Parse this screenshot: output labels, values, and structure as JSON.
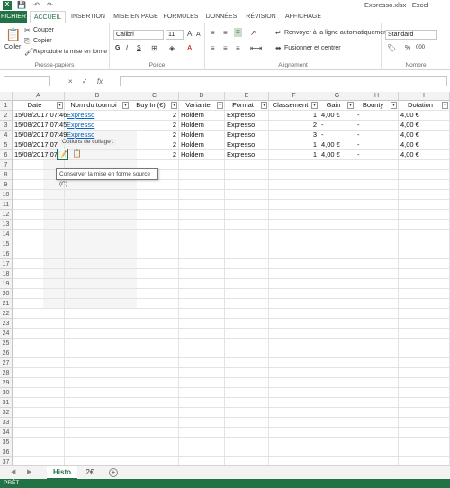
{
  "window": {
    "title": "Expresso.xlsx - Excel",
    "app_icon": "X"
  },
  "qat": {
    "save_icon": "save-icon",
    "undo_icon": "undo-icon",
    "redo_icon": "redo-icon"
  },
  "tabs": [
    "FICHIER",
    "ACCUEIL",
    "INSERTION",
    "MISE EN PAGE",
    "FORMULES",
    "DONNÉES",
    "RÉVISION",
    "AFFICHAGE"
  ],
  "ribbon": {
    "clipboard": {
      "cut": "Couper",
      "copy": "Copier",
      "paste": "Coller",
      "painter": "Reproduire la mise en forme",
      "label": "Presse-papiers"
    },
    "font": {
      "name": "Calibri",
      "size": "11",
      "bold": "G",
      "italic": "I",
      "underline": "S",
      "label": "Police"
    },
    "alignment": {
      "wrap": "Renvoyer à la ligne automatiquement",
      "merge": "Fusionner et centrer",
      "label": "Alignement"
    },
    "number": {
      "format": "Standard",
      "percent": "%",
      "thousands": "000",
      "label": "Nombre"
    }
  },
  "formula_bar": {
    "name_box": "",
    "fx": "fx",
    "cancel": "×",
    "enter": "✓",
    "value": ""
  },
  "columns": [
    "A",
    "B",
    "C",
    "D",
    "E",
    "F",
    "G",
    "H",
    "I"
  ],
  "headers": [
    "Date",
    "Nom du tournoi",
    "Buy In (€)",
    "Variante",
    "Format",
    "Classement",
    "Gain",
    "Bounty",
    "Dotation"
  ],
  "rows": [
    [
      "15/08/2017 07:46",
      "Expresso",
      "2",
      "Holdem",
      "Expresso",
      "1",
      "4,00 €",
      "-",
      "4,00 €"
    ],
    [
      "15/08/2017 07:45",
      "Expresso",
      "2",
      "Holdem",
      "Expresso",
      "2",
      "-",
      "-",
      "4,00 €"
    ],
    [
      "15/08/2017 07:49",
      "Expresso",
      "2",
      "Holdem",
      "Expresso",
      "3",
      "-",
      "-",
      "4,00 €"
    ],
    [
      "15/08/2017 07",
      "",
      "2",
      "Holdem",
      "Expresso",
      "1",
      "4,00 €",
      "-",
      "4,00 €"
    ],
    [
      "15/08/2017 07",
      "",
      "2",
      "Holdem",
      "Expresso",
      "1",
      "4,00 €",
      "-",
      "4,00 €"
    ]
  ],
  "row_numbers": [
    "1",
    "2",
    "3",
    "4",
    "5",
    "6",
    "7",
    "8",
    "9",
    "10",
    "11",
    "12",
    "13",
    "14",
    "15",
    "16",
    "17",
    "18",
    "19",
    "20",
    "21",
    "22",
    "23",
    "24",
    "25",
    "26",
    "27",
    "28",
    "29",
    "30",
    "31",
    "32",
    "33",
    "34",
    "35",
    "36",
    "37",
    "38"
  ],
  "paste_options": {
    "label": "Options de collage :",
    "tooltip": "Conserver la mise en forme source (C)"
  },
  "sheets": {
    "active": "Histo",
    "other": "2€",
    "add": "+"
  },
  "status": "PRÊT",
  "colors": {
    "accent": "#217346",
    "link": "#0563c1"
  }
}
